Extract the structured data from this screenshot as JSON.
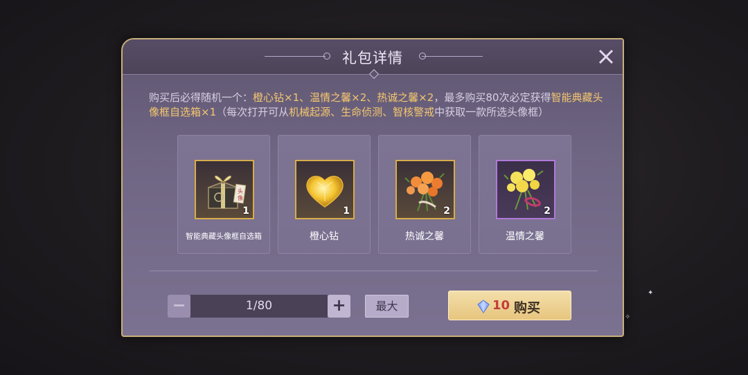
{
  "dialog": {
    "title": "礼包详情",
    "description": {
      "p1": "购买后必得随机一个：",
      "p2": "橙心钻×1、温情之馨×2、热诚之馨×2",
      "p3": "，最多购买80次必定获得",
      "p4": "智能典藏头像框自选箱×1",
      "p5": "（每次打开可从",
      "p6": "机械起源、生命侦测、智核警戒",
      "p7": "中获取一款所选头像框）"
    },
    "items": [
      {
        "name": "智能典藏头像框自选箱",
        "qty": "1",
        "icon": "avatar-frame-giftbox-icon"
      },
      {
        "name": "橙心钻",
        "qty": "1",
        "icon": "orange-heart-diamond-icon"
      },
      {
        "name": "热诚之馨",
        "qty": "2",
        "icon": "orange-rose-bouquet-icon"
      },
      {
        "name": "温情之馨",
        "qty": "2",
        "icon": "yellow-rose-bouquet-icon"
      }
    ],
    "quantity": {
      "minus": "−",
      "count": "1/80",
      "plus": "+"
    },
    "max_label": "最大",
    "buy": {
      "price": "10",
      "label": "购买",
      "currency_icon": "diamond-gem-icon"
    },
    "close_icon": "close-icon"
  },
  "colors": {
    "highlight": "#f5c76e",
    "frame_gold": "#d7ad4c",
    "frame_purple": "#b07ad8",
    "price_red": "#c33b3b"
  }
}
